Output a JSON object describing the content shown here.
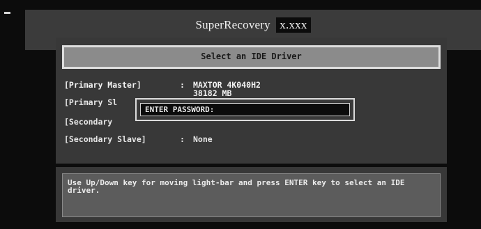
{
  "title": {
    "app_name": "SuperRecovery",
    "version": "x.xxx"
  },
  "header": {
    "label": "Select an IDE Driver"
  },
  "drives": [
    {
      "slot": "[Primary Master]",
      "separator": ":",
      "value": "MAXTOR 4K040H2",
      "detail": "38182 MB"
    },
    {
      "slot": "[Primary Sl"
    },
    {
      "slot": "[Secondary"
    },
    {
      "slot": "[Secondary Slave]",
      "separator": ":",
      "value": "None"
    }
  ],
  "password_dialog": {
    "label": "ENTER PASSWORD:",
    "value": ""
  },
  "help": {
    "text": "Use Up/Down key for moving light-bar and press ENTER key to select an IDE driver."
  },
  "colors": {
    "background": "#0c0c0c",
    "panel": "#383838",
    "header_fill": "#8b8b8b",
    "header_border": "#dedede",
    "text": "#e4e4e4"
  }
}
